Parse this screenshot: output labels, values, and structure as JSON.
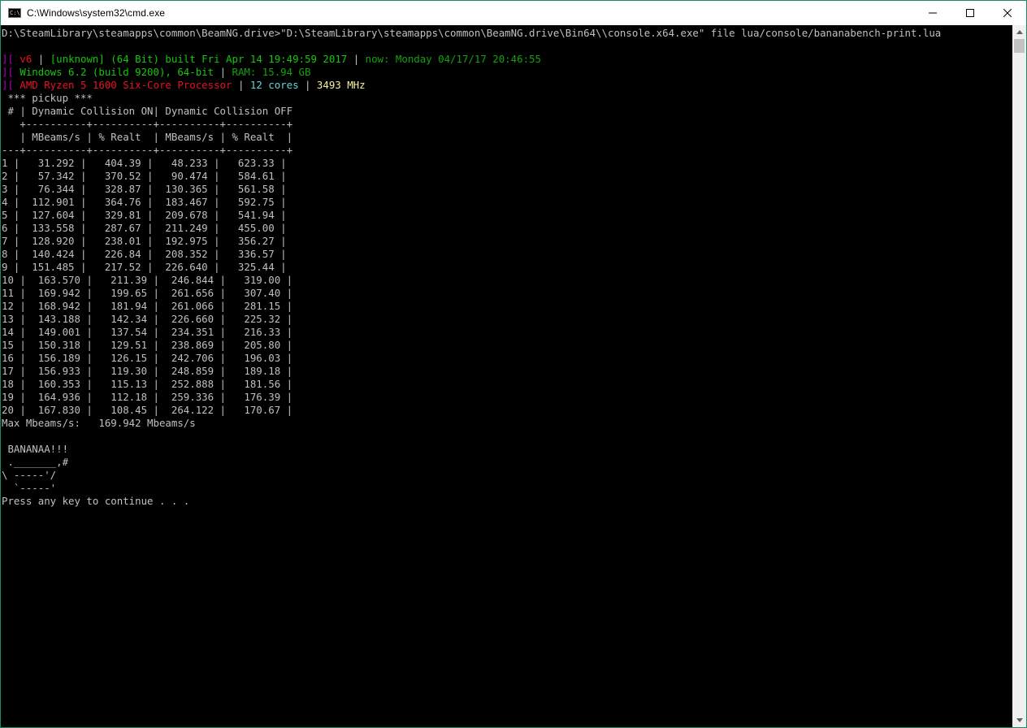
{
  "window": {
    "title": "C:\\Windows\\system32\\cmd.exe",
    "icon_text": "C:\\"
  },
  "colors": {
    "default": "#c0c0c0",
    "magenta": "#b000c0",
    "red": "#e81123",
    "green": "#16c60c",
    "darkgreen": "#13a10e",
    "gray": "#767676",
    "cyan": "#3a96dd",
    "yellow": "#f9f1a5",
    "brightcyan": "#61d6d6",
    "brightyellow": "#f9f1a5"
  },
  "console_lines": [
    [
      {
        "t": "D:\\SteamLibrary\\steamapps\\common\\BeamNG.drive>\"D:\\SteamLibrary\\steamapps\\common\\BeamNG.drive\\Bin64\\\\console.x64.exe\" file lua/console/bananabench-print.lua",
        "c": "default"
      }
    ],
    [
      {
        "t": "",
        "c": "default"
      }
    ],
    [
      {
        "t": "][",
        "c": "magenta"
      },
      {
        "t": " v6 ",
        "c": "red"
      },
      {
        "t": "| ",
        "c": "default"
      },
      {
        "t": "[unknown] (64 Bit) built Fri Apr 14 19:49:59 2017 ",
        "c": "green"
      },
      {
        "t": "| ",
        "c": "default"
      },
      {
        "t": "now: Monday 04/17/17 20:46:55",
        "c": "darkgreen"
      }
    ],
    [
      {
        "t": "][",
        "c": "magenta"
      },
      {
        "t": " Windows 6.2 (build 9200), 64-bit ",
        "c": "green"
      },
      {
        "t": "| ",
        "c": "default"
      },
      {
        "t": "RAM: 15.94 GB",
        "c": "darkgreen"
      }
    ],
    [
      {
        "t": "][",
        "c": "magenta"
      },
      {
        "t": " AMD Ryzen 5 1600 Six-Core Processor ",
        "c": "red"
      },
      {
        "t": "| ",
        "c": "default"
      },
      {
        "t": "12 cores ",
        "c": "brightcyan"
      },
      {
        "t": "| ",
        "c": "default"
      },
      {
        "t": "3493 MHz",
        "c": "brightyellow"
      }
    ],
    [
      {
        "t": " *** pickup ***",
        "c": "default"
      }
    ],
    [
      {
        "t": " # | Dynamic Collision ON| Dynamic Collision OFF",
        "c": "default"
      }
    ],
    [
      {
        "t": "   +----------+----------+----------+----------+",
        "c": "default"
      }
    ],
    [
      {
        "t": "   | MBeams/s | % Realt  | MBeams/s | % Realt  |",
        "c": "default"
      }
    ],
    [
      {
        "t": "---+----------+----------+----------+----------+",
        "c": "default"
      }
    ],
    [
      {
        "t": "1 |   31.292 |   404.39 |   48.233 |   623.33 |",
        "c": "default"
      }
    ],
    [
      {
        "t": "2 |   57.342 |   370.52 |   90.474 |   584.61 |",
        "c": "default"
      }
    ],
    [
      {
        "t": "3 |   76.344 |   328.87 |  130.365 |   561.58 |",
        "c": "default"
      }
    ],
    [
      {
        "t": "4 |  112.901 |   364.76 |  183.467 |   592.75 |",
        "c": "default"
      }
    ],
    [
      {
        "t": "5 |  127.604 |   329.81 |  209.678 |   541.94 |",
        "c": "default"
      }
    ],
    [
      {
        "t": "6 |  133.558 |   287.67 |  211.249 |   455.00 |",
        "c": "default"
      }
    ],
    [
      {
        "t": "7 |  128.920 |   238.01 |  192.975 |   356.27 |",
        "c": "default"
      }
    ],
    [
      {
        "t": "8 |  140.424 |   226.84 |  208.352 |   336.57 |",
        "c": "default"
      }
    ],
    [
      {
        "t": "9 |  151.485 |   217.52 |  226.640 |   325.44 |",
        "c": "default"
      }
    ],
    [
      {
        "t": "10 |  163.570 |   211.39 |  246.844 |   319.00 |",
        "c": "default"
      }
    ],
    [
      {
        "t": "11 |  169.942 |   199.65 |  261.656 |   307.40 |",
        "c": "default"
      }
    ],
    [
      {
        "t": "12 |  168.942 |   181.94 |  261.066 |   281.15 |",
        "c": "default"
      }
    ],
    [
      {
        "t": "13 |  143.188 |   142.34 |  226.660 |   225.32 |",
        "c": "default"
      }
    ],
    [
      {
        "t": "14 |  149.001 |   137.54 |  234.351 |   216.33 |",
        "c": "default"
      }
    ],
    [
      {
        "t": "15 |  150.318 |   129.51 |  238.869 |   205.80 |",
        "c": "default"
      }
    ],
    [
      {
        "t": "16 |  156.189 |   126.15 |  242.706 |   196.03 |",
        "c": "default"
      }
    ],
    [
      {
        "t": "17 |  156.933 |   119.30 |  248.859 |   189.18 |",
        "c": "default"
      }
    ],
    [
      {
        "t": "18 |  160.353 |   115.13 |  252.888 |   181.56 |",
        "c": "default"
      }
    ],
    [
      {
        "t": "19 |  164.936 |   112.18 |  259.336 |   176.39 |",
        "c": "default"
      }
    ],
    [
      {
        "t": "20 |  167.830 |   108.45 |  264.122 |   170.67 |",
        "c": "default"
      }
    ],
    [
      {
        "t": "Max Mbeams/s:   169.942 Mbeams/s",
        "c": "default"
      }
    ],
    [
      {
        "t": "",
        "c": "default"
      }
    ],
    [
      {
        "t": " BANANAA!!!",
        "c": "default"
      }
    ],
    [
      {
        "t": " ._______,#",
        "c": "default"
      }
    ],
    [
      {
        "t": "\\ -----'/",
        "c": "default"
      }
    ],
    [
      {
        "t": "  `-----'",
        "c": "default"
      }
    ],
    [
      {
        "t": "Press any key to continue . . .",
        "c": "default"
      }
    ]
  ]
}
